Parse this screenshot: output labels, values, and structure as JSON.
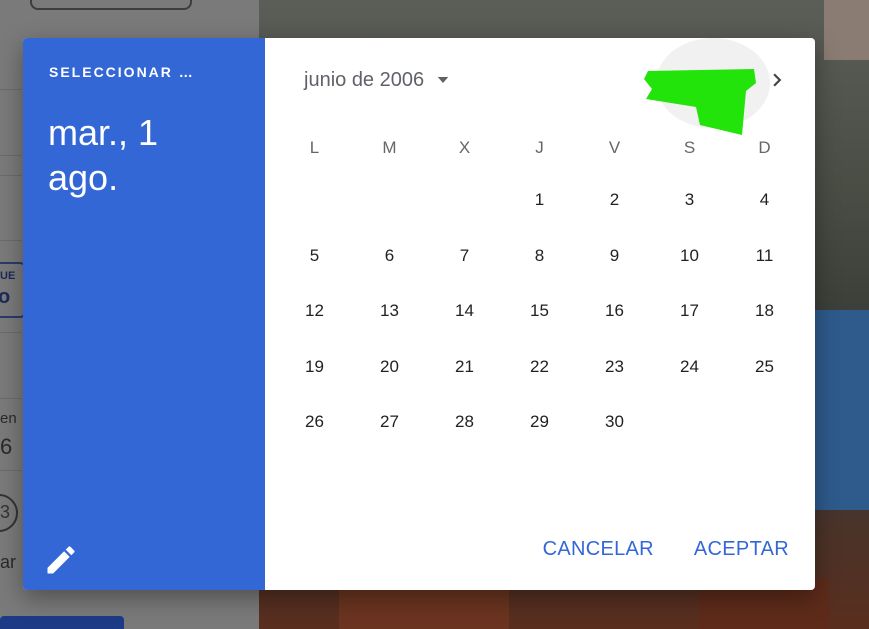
{
  "background": {
    "tag_top": "UE",
    "tag_bottom": "o",
    "snippet_1": "en",
    "snippet_2": "6",
    "snippet_3": "ar",
    "circle_glyph": "3"
  },
  "dialog": {
    "header": {
      "label": "SELECCIONAR …",
      "selected_date_line1": "mar., 1",
      "selected_date_line2": "ago."
    },
    "month_label": "junio de 2006",
    "weekdays": [
      "L",
      "M",
      "X",
      "J",
      "V",
      "S",
      "D"
    ],
    "weeks": [
      [
        "",
        "",
        "",
        "1",
        "2",
        "3",
        "4"
      ],
      [
        "5",
        "6",
        "7",
        "8",
        "9",
        "10",
        "11"
      ],
      [
        "12",
        "13",
        "14",
        "15",
        "16",
        "17",
        "18"
      ],
      [
        "19",
        "20",
        "21",
        "22",
        "23",
        "24",
        "25"
      ],
      [
        "26",
        "27",
        "28",
        "29",
        "30",
        "",
        ""
      ]
    ],
    "actions": {
      "cancel_label": "CANCELAR",
      "accept_label": "ACEPTAR"
    },
    "icons": {
      "edit": "pencil-icon",
      "prev": "chevron-left-icon",
      "next": "chevron-right-icon",
      "month_dropdown": "caret-down-icon"
    },
    "colors": {
      "header_bg": "#3367d6",
      "accent": "#3367d6",
      "annotation": "#22e30a"
    }
  }
}
